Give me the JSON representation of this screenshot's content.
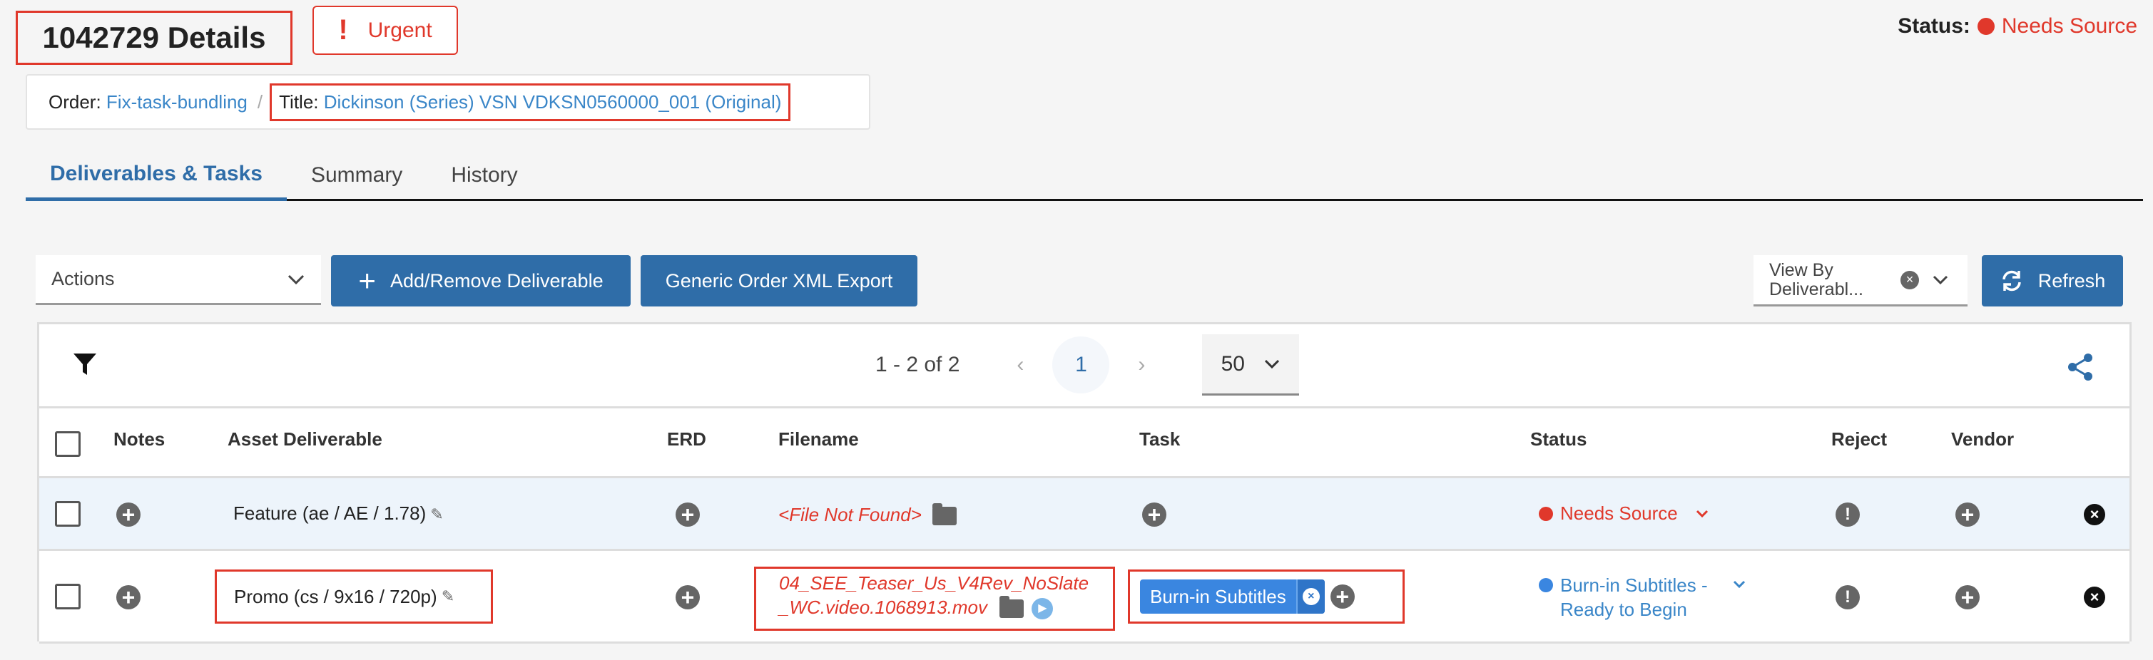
{
  "page": {
    "title": "1042729 Details",
    "urgent_label": "Urgent",
    "status_label": "Status:",
    "status_value": "Needs Source"
  },
  "breadcrumb": {
    "order_label": "Order:",
    "order_value": "Fix-task-bundling",
    "separator": "/",
    "title_label": "Title:",
    "title_value": "Dickinson (Series) VSN VDKSN0560000_001 (Original)"
  },
  "tabs": [
    {
      "label": "Deliverables & Tasks",
      "active": true
    },
    {
      "label": "Summary",
      "active": false
    },
    {
      "label": "History",
      "active": false
    }
  ],
  "toolbar": {
    "actions_label": "Actions",
    "add_remove_label": "Add/Remove Deliverable",
    "xml_export_label": "Generic Order XML Export",
    "view_by_line1": "View By",
    "view_by_line2": "Deliverabl...",
    "refresh_label": "Refresh"
  },
  "pagination": {
    "range_text": "1 - 2 of 2",
    "prev": "‹",
    "current_page": "1",
    "next": "›",
    "per_page": "50"
  },
  "columns": {
    "notes": "Notes",
    "asset": "Asset Deliverable",
    "erd": "ERD",
    "filename": "Filename",
    "task": "Task",
    "status": "Status",
    "reject": "Reject",
    "vendor": "Vendor"
  },
  "rows": [
    {
      "asset": "Feature (ae / AE / 1.78)",
      "filename": "<File Not Found>",
      "status": "Needs Source"
    },
    {
      "asset": "Promo (cs / 9x16 / 720p)",
      "filename_line1": "04_SEE_Teaser_Us_V4Rev_NoSlate",
      "filename_line2": "_WC.video.1068913.mov",
      "task": "Burn-in Subtitles",
      "status_line1": "Burn-in Subtitles -",
      "status_line2": "Ready to Begin"
    }
  ],
  "colors": {
    "accent": "#2f6da8",
    "link": "#3a86c8",
    "alert": "#e0382b",
    "row_highlight": "#edf4fb",
    "task_chip": "#3a86e0"
  }
}
